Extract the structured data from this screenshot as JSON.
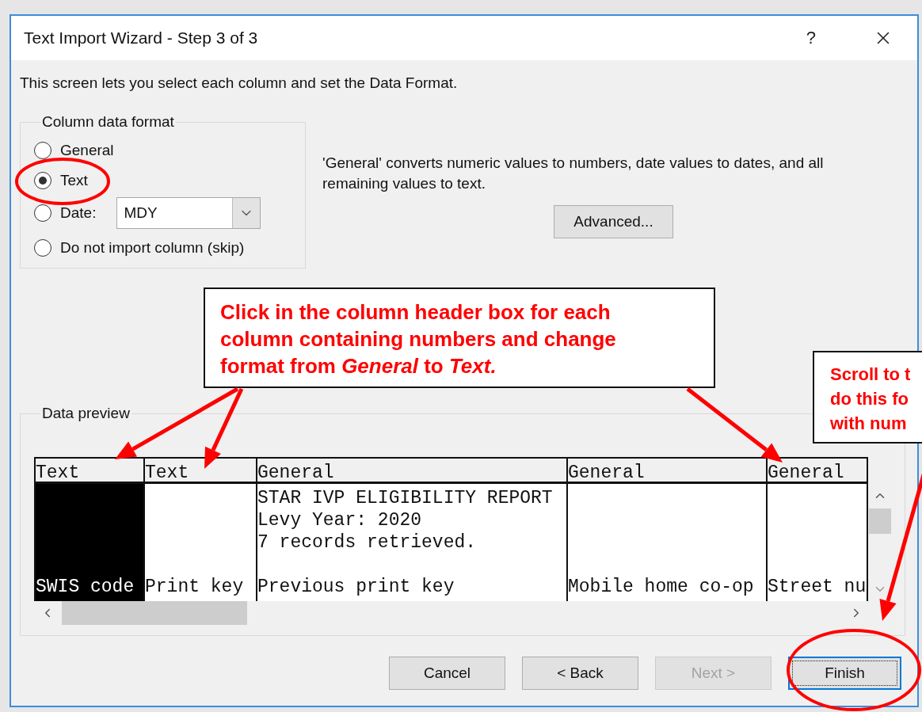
{
  "window": {
    "title": "Text Import Wizard - Step 3 of 3",
    "help": "?"
  },
  "intro": "This screen lets you select each column and set the Data Format.",
  "column_data_format": {
    "legend": "Column data format",
    "options": [
      {
        "label": "General",
        "selected": false
      },
      {
        "label": "Text",
        "selected": true
      },
      {
        "label": "Date:",
        "selected": false,
        "dropdown": "MDY"
      },
      {
        "label": "Do not import column (skip)",
        "selected": false
      }
    ]
  },
  "description": "'General' converts numeric values to numbers, date values to dates, and all remaining values to text.",
  "advanced_button": "Advanced...",
  "data_preview": {
    "legend": "Data preview",
    "columns": [
      {
        "format": "Text",
        "selected": true,
        "cells": [
          null,
          null,
          null,
          null,
          "SWIS code"
        ]
      },
      {
        "format": "Text",
        "selected": false,
        "cells": [
          null,
          null,
          null,
          null,
          "Print key"
        ]
      },
      {
        "format": "General",
        "selected": false,
        "cells": [
          "STAR IVP ELIGIBILITY REPORT",
          "Levy Year: 2020",
          "7 records retrieved.",
          null,
          "Previous print key"
        ]
      },
      {
        "format": "General",
        "selected": false,
        "cells": [
          null,
          null,
          null,
          null,
          "Mobile home co-op"
        ]
      },
      {
        "format": "General",
        "selected": false,
        "cells": [
          null,
          null,
          null,
          null,
          "Street nu"
        ]
      }
    ]
  },
  "buttons": [
    {
      "label": "Cancel",
      "disabled": false,
      "default": false
    },
    {
      "label": "< Back",
      "disabled": false,
      "default": false
    },
    {
      "label": "Next >",
      "disabled": true,
      "default": false
    },
    {
      "label": "Finish",
      "disabled": false,
      "default": true
    }
  ],
  "callouts": [
    {
      "lines": [
        "Click in the column header box for each",
        "column containing numbers and change",
        "format from *General* to *Text.*"
      ]
    },
    {
      "lines": [
        "Scroll to t",
        "do this fo",
        "with num"
      ]
    }
  ]
}
